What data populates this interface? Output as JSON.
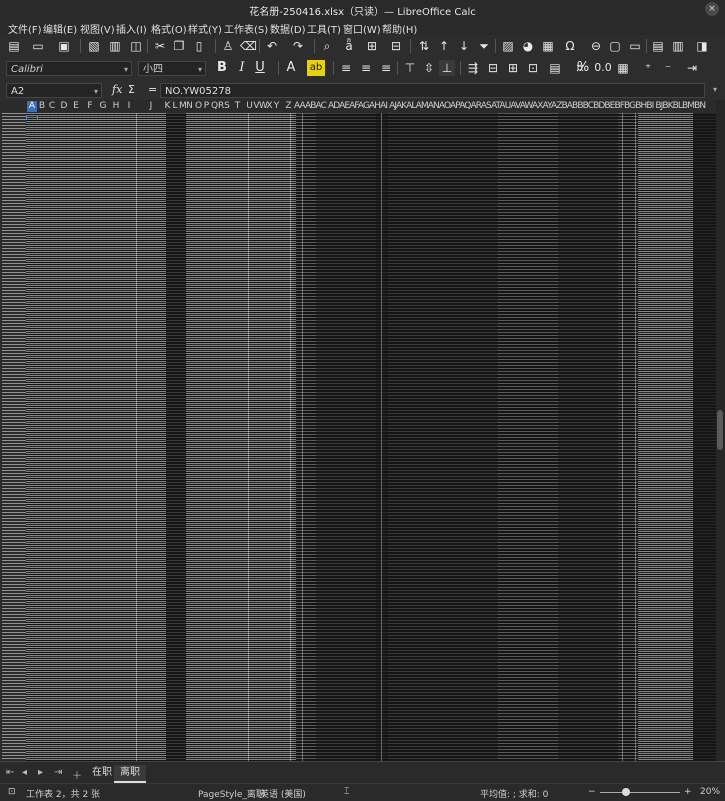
{
  "window": {
    "title": "花名册-250416.xlsx（只读）— LibreOffice Calc",
    "close_glyph": "×"
  },
  "menu": [
    "文件(F)",
    "编辑(E)",
    "视图(V)",
    "插入(I)",
    "格式(O)",
    "样式(Y)",
    "工作表(S)",
    "数据(D)",
    "工具(T)",
    "窗口(W)",
    "帮助(H)"
  ],
  "toolbar": {
    "font_name": "Calibri",
    "font_size": "小四",
    "bold": "B",
    "italic": "I",
    "underline": "U",
    "font_color": "A",
    "highlight": "ab",
    "percent": "%",
    "decimal": "0.0"
  },
  "formula_bar": {
    "cell_ref": "A2",
    "fx": "fx",
    "sigma": "Σ",
    "equals": "=",
    "content": "NO.YW05278"
  },
  "columns": {
    "selected": "A",
    "labels": [
      "B",
      "C",
      "D",
      "E",
      "F",
      "G",
      "H",
      "I",
      "J",
      "K",
      "L",
      "M",
      "N",
      "O",
      "P",
      "Q",
      "R",
      "S",
      "T",
      "U",
      "V",
      "W",
      "X",
      "Y",
      "Z"
    ],
    "rest": "AAABAC ADAEAFAGAHAI AJAKALAMANAOAPAQARASATAUAVAWAXAYAZBABBBCBDBEBFBGBHBI BJBKBLBMBN"
  },
  "sheets": {
    "tabs": [
      "在职",
      "离职"
    ],
    "active": "离职"
  },
  "status": {
    "sheet_info": "工作表 2，共 2 张",
    "page_style": "PageStyle_离职",
    "language": "英语 (美国)",
    "summary": "平均值: ; 求和: 0",
    "zoom": "20%"
  },
  "colors": {
    "background": "#1e1e1e",
    "selection": "#3c6fb6",
    "accent": "#4a8ae0"
  }
}
